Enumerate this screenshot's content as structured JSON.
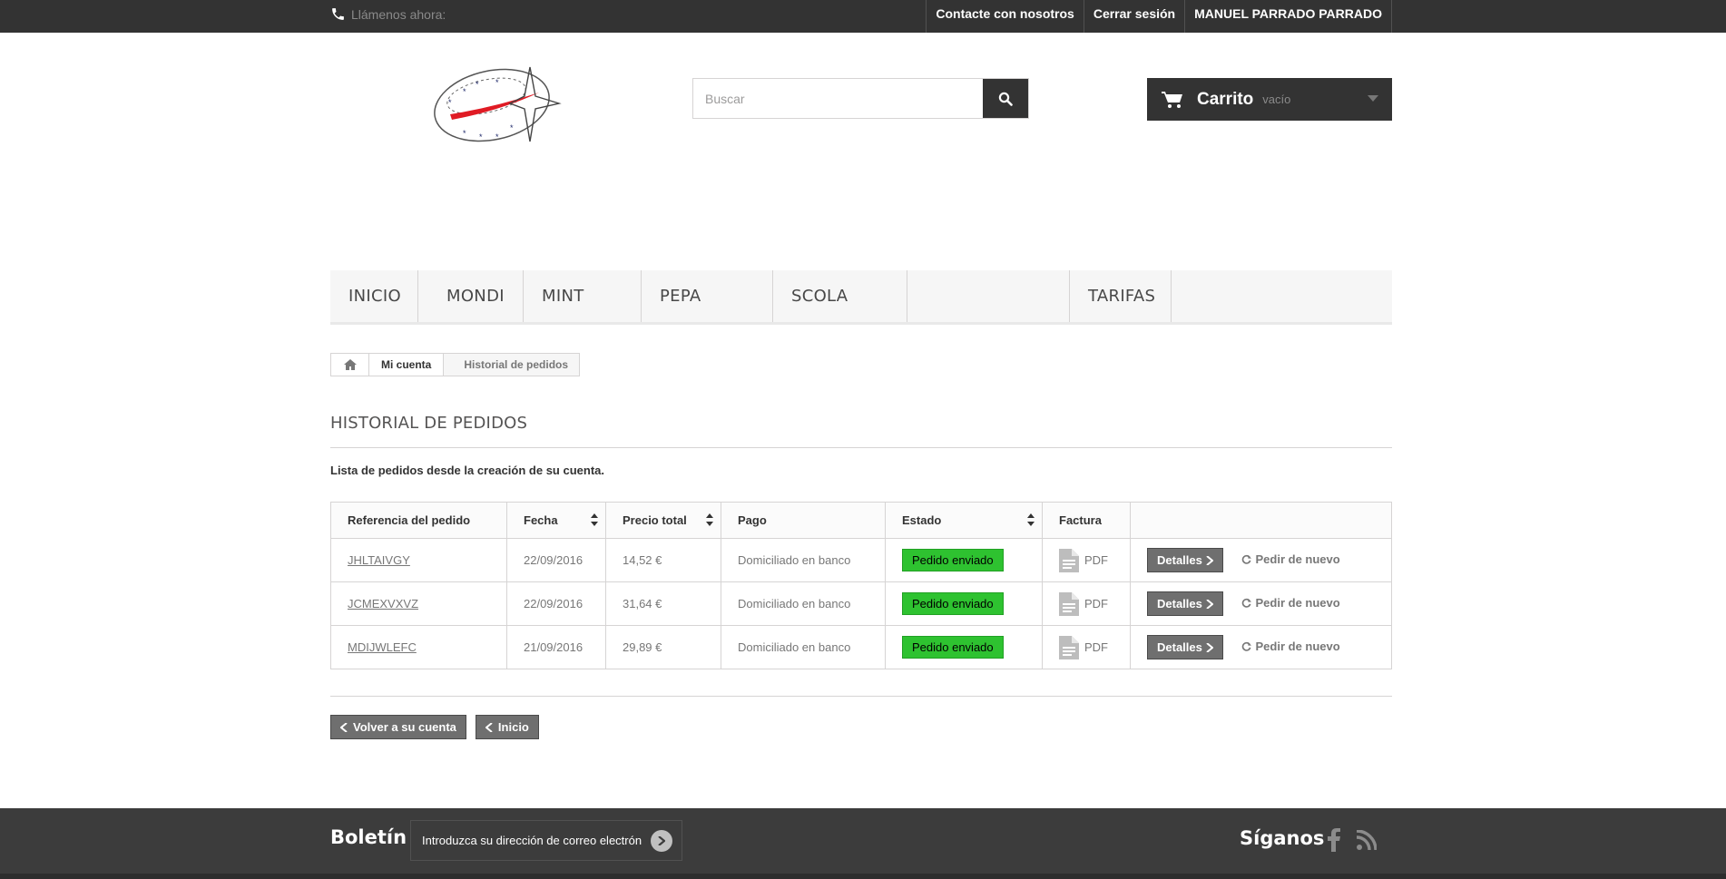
{
  "topbar": {
    "phone_label": "Llámenos ahora:",
    "links": [
      "Contacte con nosotros",
      "Cerrar sesión",
      "MANUEL PARRADO PARRADO"
    ]
  },
  "search": {
    "placeholder": "Buscar"
  },
  "cart": {
    "title": "Carrito",
    "status": "vacío"
  },
  "menu": {
    "items": [
      "INICIO",
      "MONDI",
      "MINT",
      "PEPA",
      "SCOLA",
      "",
      "TARIFAS"
    ]
  },
  "breadcrumb": {
    "items": [
      "Mi cuenta",
      "Historial de pedidos"
    ]
  },
  "page": {
    "title": "HISTORIAL DE PEDIDOS",
    "intro": "Lista de pedidos desde la creación de su cuenta."
  },
  "orders": {
    "headers": [
      "Referencia del pedido",
      "Fecha",
      "Precio total",
      "Pago",
      "Estado",
      "Factura",
      ""
    ],
    "rows": [
      {
        "ref": "JHLTAIVGY",
        "date": "22/09/2016",
        "total": "14,52 €",
        "payment": "Domiciliado en banco",
        "status": "Pedido enviado",
        "invoice": "PDF",
        "details": "Detalles",
        "reorder": "Pedir de nuevo"
      },
      {
        "ref": "JCMEXVXVZ",
        "date": "22/09/2016",
        "total": "31,64 €",
        "payment": "Domiciliado en banco",
        "status": "Pedido enviado",
        "invoice": "PDF",
        "details": "Detalles",
        "reorder": "Pedir de nuevo"
      },
      {
        "ref": "MDIJWLEFC",
        "date": "21/09/2016",
        "total": "29,89 €",
        "payment": "Domiciliado en banco",
        "status": "Pedido enviado",
        "invoice": "PDF",
        "details": "Detalles",
        "reorder": "Pedir de nuevo"
      }
    ]
  },
  "footer_buttons": {
    "back_account": "Volver a su cuenta",
    "home": "Inicio"
  },
  "footer": {
    "newsletter_title": "Boletín",
    "newsletter_placeholder": "Introduzca su dirección de correo electrón",
    "follow_title": "Síganos"
  },
  "colors": {
    "topbar": "#333333",
    "status_green": "#2ec230",
    "button_grey": "#6f6f6f",
    "footer": "#3c3c3c"
  }
}
